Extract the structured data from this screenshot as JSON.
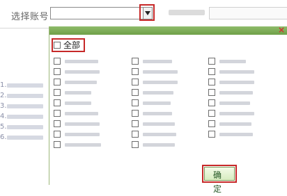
{
  "form": {
    "account_label": "选择账号：",
    "account_value": "",
    "second_label": "",
    "second_value": ""
  },
  "background_rows": [
    {
      "num": "1.",
      "text": ""
    },
    {
      "num": "2.",
      "text": ""
    },
    {
      "num": "3.",
      "text": ""
    },
    {
      "num": "4.",
      "text": ""
    },
    {
      "num": "5.",
      "text": ""
    },
    {
      "num": "6.",
      "text": ""
    }
  ],
  "popup": {
    "close_symbol": "×",
    "select_all_label": "全部",
    "confirm_label": "确定",
    "accounts": [
      {
        "label": ""
      },
      {
        "label": ""
      },
      {
        "label": ""
      },
      {
        "label": ""
      },
      {
        "label": ""
      },
      {
        "label": ""
      },
      {
        "label": ""
      },
      {
        "label": ""
      },
      {
        "label": ""
      },
      {
        "label": ""
      },
      {
        "label": ""
      },
      {
        "label": ""
      },
      {
        "label": ""
      },
      {
        "label": ""
      },
      {
        "label": ""
      },
      {
        "label": ""
      },
      {
        "label": ""
      },
      {
        "label": ""
      },
      {
        "label": ""
      },
      {
        "label": ""
      },
      {
        "label": ""
      },
      {
        "label": ""
      },
      {
        "label": ""
      },
      {
        "label": ""
      },
      {
        "label": ""
      },
      {
        "label": ""
      }
    ]
  },
  "colors": {
    "header_green": "#7fae5a",
    "highlight_red": "#c62828",
    "close_red": "#d32f2f"
  }
}
